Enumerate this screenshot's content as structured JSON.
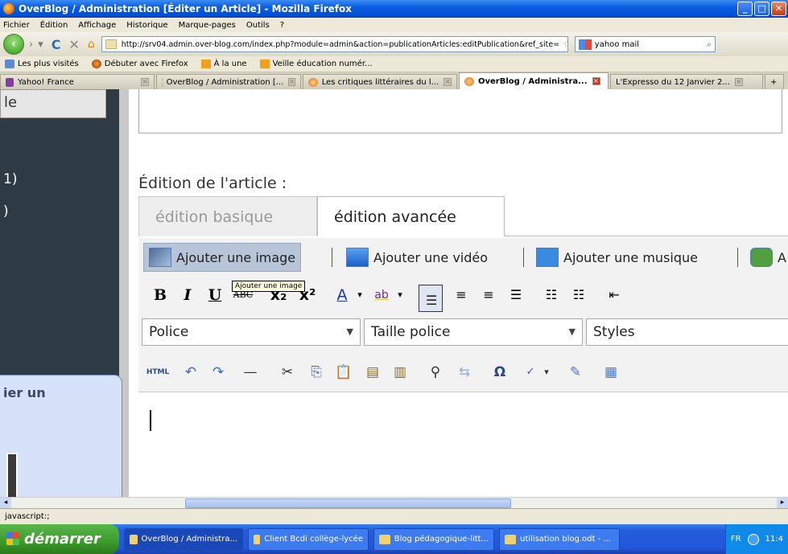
{
  "window": {
    "title": "OverBlog / Administration [Éditer un Article] - Mozilla Firefox"
  },
  "menubar": [
    "Fichier",
    "Édition",
    "Affichage",
    "Historique",
    "Marque-pages",
    "Outils",
    "?"
  ],
  "nav": {
    "url": "http://srv04.admin.over-blog.com/index.php?module=admin&action=publicationArticles:editPublication&ref_site=",
    "search_value": "yahoo mail"
  },
  "bookmarks": [
    "Les plus visités",
    "Débuter avec Firefox",
    "À la une",
    "Veille éducation numér..."
  ],
  "tabs": [
    {
      "label": "Yahoo! France",
      "active": false
    },
    {
      "label": "OverBlog / Administration [...",
      "active": false
    },
    {
      "label": "Les critiques littéraires du l...",
      "active": false
    },
    {
      "label": "OverBlog / Administra...",
      "active": true
    },
    {
      "label": "L'Expresso du 12 Janvier 2...",
      "active": false
    }
  ],
  "sidebar": {
    "button_fragment": "le",
    "text1": "1)",
    "text2": ")",
    "panel_label": "ier un"
  },
  "editor": {
    "section_label": "Édition de l'article :",
    "tab_basic": "édition basique",
    "tab_advanced": "édition avancée",
    "media": {
      "add_image": "Ajouter une image",
      "add_video": "Ajouter une vidéo",
      "add_music": "Ajouter une musique",
      "add_link_fragment": "A"
    },
    "tooltip": "Ajouter une image",
    "format": {
      "bold": "B",
      "italic": "I",
      "underline": "U",
      "strike": "ABC",
      "subscript": "x₂",
      "superscript": "x²",
      "font_color": "A",
      "highlight": "ab"
    },
    "selects": {
      "font": "Police",
      "size": "Taille police",
      "styles": "Styles"
    },
    "misc": {
      "html": "HTML"
    }
  },
  "statusbar": "javascript:;",
  "taskbar": {
    "start": "démarrer",
    "tasks": [
      "OverBlog / Administra...",
      "Client Bcdi collège-lycée",
      "Blog pédagogique-litt...",
      "utilisation blog.odt - ..."
    ],
    "lang": "FR",
    "clock": "11:4"
  }
}
